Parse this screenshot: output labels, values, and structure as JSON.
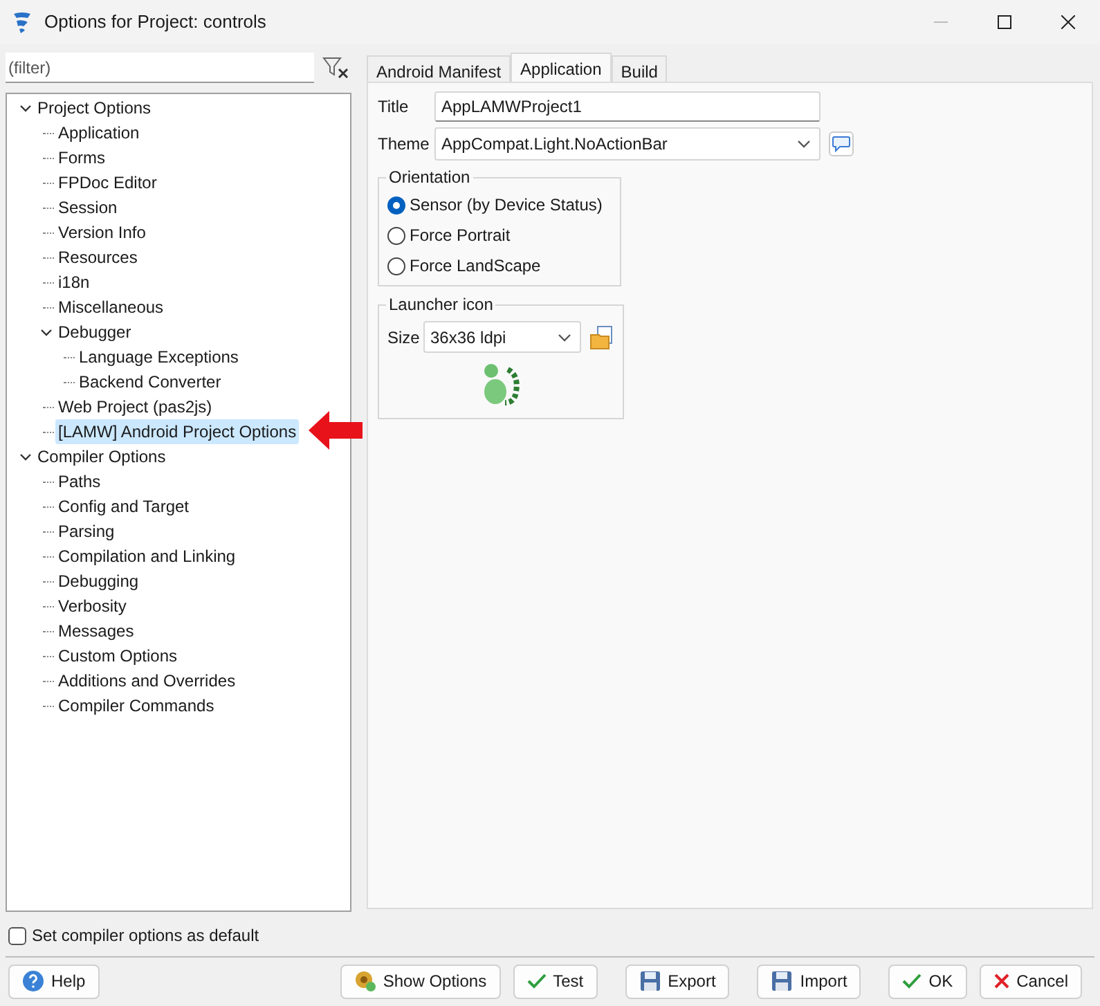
{
  "window": {
    "title": "Options for Project: controls"
  },
  "filter": {
    "placeholder": "(filter)"
  },
  "tree": [
    {
      "label": "Project Options",
      "expanded": true,
      "selected": false,
      "children": [
        {
          "label": "Application",
          "selected": false
        },
        {
          "label": "Forms",
          "selected": false
        },
        {
          "label": "FPDoc Editor",
          "selected": false
        },
        {
          "label": "Session",
          "selected": false
        },
        {
          "label": "Version Info",
          "selected": false
        },
        {
          "label": "Resources",
          "selected": false
        },
        {
          "label": "i18n",
          "selected": false
        },
        {
          "label": "Miscellaneous",
          "selected": false
        },
        {
          "label": "Debugger",
          "expanded": true,
          "selected": false,
          "children": [
            {
              "label": "Language Exceptions",
              "selected": false
            },
            {
              "label": "Backend Converter",
              "selected": false
            }
          ]
        },
        {
          "label": "Web Project (pas2js)",
          "selected": false
        },
        {
          "label": "[LAMW] Android Project Options",
          "selected": true
        }
      ]
    },
    {
      "label": "Compiler Options",
      "expanded": true,
      "selected": false,
      "children": [
        {
          "label": "Paths",
          "selected": false
        },
        {
          "label": "Config and Target",
          "selected": false
        },
        {
          "label": "Parsing",
          "selected": false
        },
        {
          "label": "Compilation and Linking",
          "selected": false
        },
        {
          "label": "Debugging",
          "selected": false
        },
        {
          "label": "Verbosity",
          "selected": false
        },
        {
          "label": "Messages",
          "selected": false
        },
        {
          "label": "Custom Options",
          "selected": false
        },
        {
          "label": "Additions and Overrides",
          "selected": false
        },
        {
          "label": "Compiler Commands",
          "selected": false
        }
      ]
    }
  ],
  "default_checkbox": {
    "label": "Set compiler options as default",
    "checked": false
  },
  "tabs": [
    {
      "label": "Android Manifest",
      "selected": false
    },
    {
      "label": "Application",
      "selected": true
    },
    {
      "label": "Build",
      "selected": false
    }
  ],
  "title_field": {
    "label": "Title",
    "value": "AppLAMWProject1"
  },
  "theme_field": {
    "label": "Theme",
    "value": "AppCompat.Light.NoActionBar"
  },
  "orientation": {
    "title": "Orientation",
    "options": [
      {
        "label": "Sensor (by Device Status)",
        "selected": true
      },
      {
        "label": "Force Portrait",
        "selected": false
      },
      {
        "label": "Force LandScape",
        "selected": false
      }
    ]
  },
  "launcher_icon": {
    "title": "Launcher icon",
    "size_label": "Size",
    "size_value": "36x36 ldpi"
  },
  "buttons": [
    {
      "label": "Help",
      "kind": "help"
    },
    {
      "label": "Show Options",
      "kind": "options"
    },
    {
      "label": "Test",
      "kind": "check"
    },
    {
      "label": "Export",
      "kind": "save"
    },
    {
      "label": "Import",
      "kind": "save"
    },
    {
      "label": "OK",
      "kind": "check"
    },
    {
      "label": "Cancel",
      "kind": "cross"
    }
  ]
}
